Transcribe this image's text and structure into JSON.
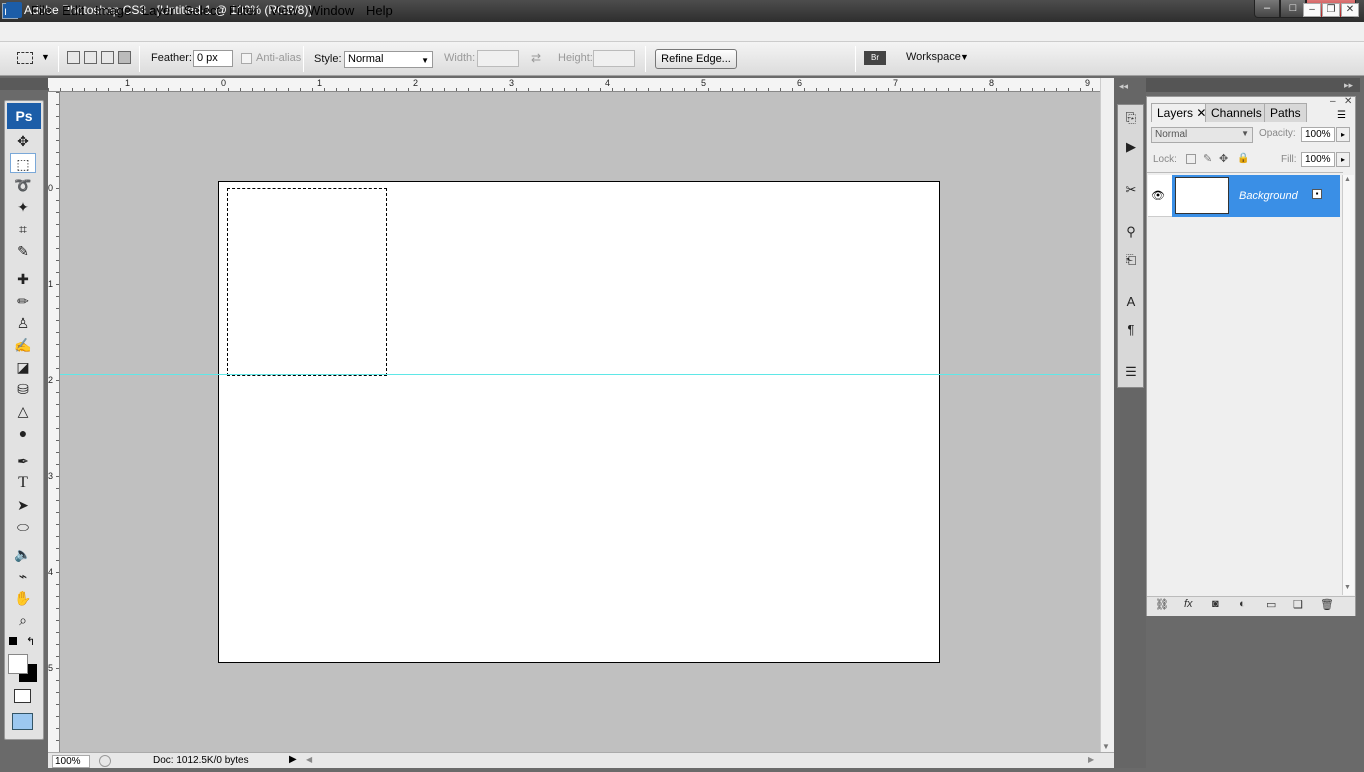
{
  "window": {
    "title": "Adobe Photoshop CS3 - [Untitled-1 @ 100% (RGB/8)]",
    "minimize": "–",
    "maximize": "□",
    "close": "✕"
  },
  "menu": {
    "items": [
      "File",
      "Edit",
      "Image",
      "Layer",
      "Select",
      "Filter",
      "View",
      "Window",
      "Help"
    ],
    "doc_min": "–",
    "doc_restore": "❐",
    "doc_close": "✕"
  },
  "options": {
    "feather_label": "Feather:",
    "feather_value": "0 px",
    "antialias_label": "Anti-alias",
    "style_label": "Style:",
    "style_value": "Normal",
    "width_label": "Width:",
    "height_label": "Height:",
    "refine_edge": "Refine Edge...",
    "workspace_label": "Workspace"
  },
  "toolbox": {
    "badge": "Ps"
  },
  "ruler": {
    "top": [
      "1",
      "0",
      "1",
      "2",
      "3",
      "4",
      "5",
      "6",
      "7",
      "8",
      "9"
    ],
    "left": [
      "0",
      "1",
      "2",
      "3",
      "4",
      "5"
    ]
  },
  "status": {
    "zoom": "100%",
    "doc": "Doc: 1012.5K/0 bytes"
  },
  "layers": {
    "tabs": [
      "Layers",
      "Channels",
      "Paths"
    ],
    "blend_mode": "Normal",
    "opacity_label": "Opacity:",
    "opacity_value": "100%",
    "lock_label": "Lock:",
    "fill_label": "Fill:",
    "fill_value": "100%",
    "layer_name": "Background"
  }
}
